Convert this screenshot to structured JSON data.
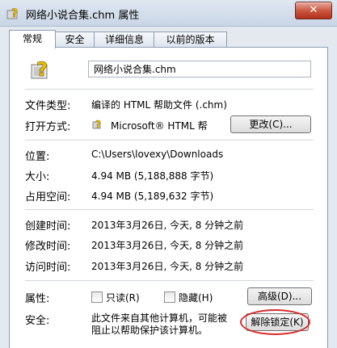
{
  "window": {
    "title": "网络小说合集.chm 属性",
    "close_glyph": "✕"
  },
  "tabs": [
    {
      "label": "常规"
    },
    {
      "label": "安全"
    },
    {
      "label": "详细信息"
    },
    {
      "label": "以前的版本"
    }
  ],
  "general": {
    "file_name": "网络小说合集.chm",
    "file_type_label": "文件类型:",
    "file_type_value": "编译的 HTML 帮助文件 (.chm)",
    "open_with_label": "打开方式:",
    "open_with_value": "Microsoft® HTML 帮",
    "change_button": "更改(C)...",
    "location_label": "位置:",
    "location_value": "C:\\Users\\lovexy\\Downloads",
    "size_label": "大小:",
    "size_value": "4.94 MB (5,188,888 字节)",
    "size_on_disk_label": "占用空间:",
    "size_on_disk_value": "4.94 MB (5,189,632 字节)",
    "created_label": "创建时间:",
    "created_value": "2013年3月26日, 今天, 8 分钟之前",
    "modified_label": "修改时间:",
    "modified_value": "2013年3月26日, 今天, 8 分钟之前",
    "accessed_label": "访问时间:",
    "accessed_value": "2013年3月26日, 今天, 8 分钟之前",
    "attributes_label": "属性:",
    "readonly_label": "只读(R)",
    "hidden_label": "隐藏(H)",
    "advanced_button": "高级(D)...",
    "security_label": "安全:",
    "security_text_line1": "此文件来自其他计算机，可能被",
    "security_text_line2": "阻止以帮助保护该计算机。",
    "unblock_button": "解除锁定(K)"
  },
  "colors": {
    "annotation_ring": "#d82b2b",
    "icon_yellow": "#f2c200"
  }
}
